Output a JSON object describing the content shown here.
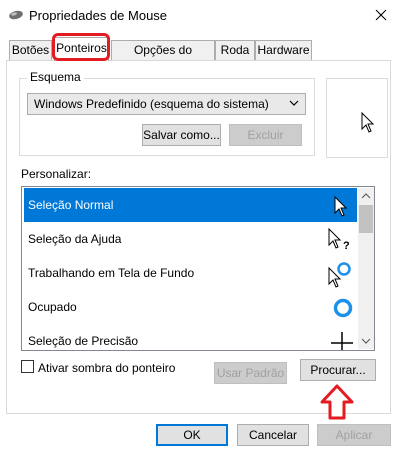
{
  "window": {
    "title": "Propriedades de Mouse",
    "close_glyph": "✕"
  },
  "tabs": [
    {
      "label": "Botões"
    },
    {
      "label": "Ponteiros"
    },
    {
      "label": "Opções do Ponteiro"
    },
    {
      "label": "Roda"
    },
    {
      "label": "Hardware"
    }
  ],
  "active_tab": "Ponteiros",
  "scheme": {
    "group_label": "Esquema",
    "selected": "Windows Predefinido (esquema do sistema)",
    "save_label": "Salvar como...",
    "delete_label": "Excluir"
  },
  "customize": {
    "label": "Personalizar:",
    "items": [
      {
        "label": "Seleção Normal",
        "icon": "arrow-cursor-icon",
        "selected": true
      },
      {
        "label": "Seleção da Ajuda",
        "icon": "help-cursor-icon"
      },
      {
        "label": "Trabalhando em Tela de Fundo",
        "icon": "working-cursor-icon"
      },
      {
        "label": "Ocupado",
        "icon": "busy-cursor-icon"
      },
      {
        "label": "Seleção de Precisão",
        "icon": "precision-cursor-icon"
      }
    ]
  },
  "shadow": {
    "label": "Ativar sombra do ponteiro",
    "checked": false
  },
  "actions": {
    "default_label": "Usar Padrão",
    "browse_label": "Procurar..."
  },
  "footer": {
    "ok_label": "OK",
    "cancel_label": "Cancelar",
    "apply_label": "Aplicar"
  },
  "colors": {
    "highlight_red": "#e31b23",
    "selection_blue": "#0078d7"
  }
}
